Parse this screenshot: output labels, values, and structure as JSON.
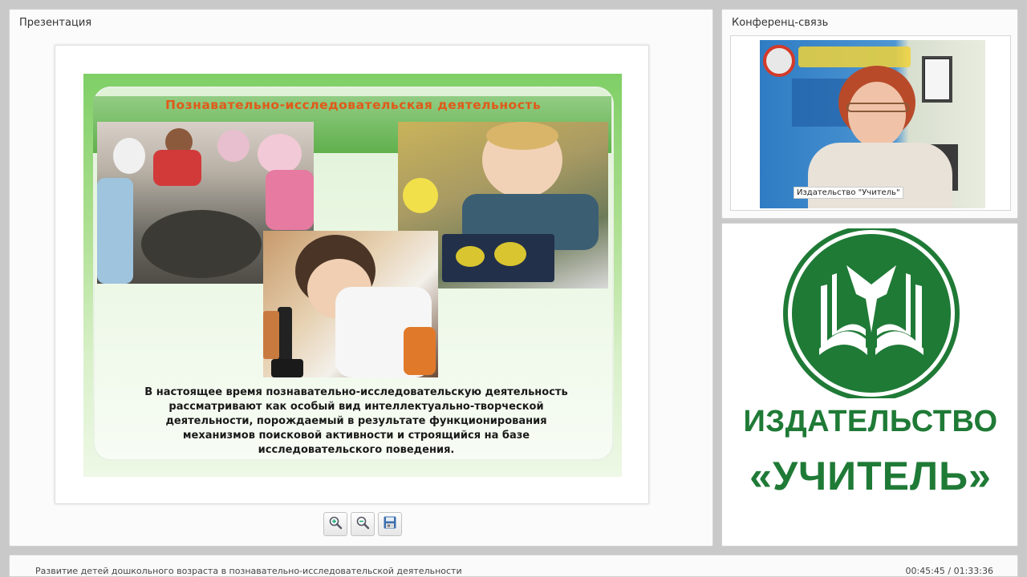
{
  "presentation": {
    "title": "Презентация",
    "slide": {
      "heading": "Познавательно-исследовательская деятельность",
      "text": "В настоящее время познавательно-исследовательскую деятельность рассматривают как особый вид интеллектуально-творческой деятельности, порождаемый в результате функционирования механизмов поисковой активности и строящийся на базе исследовательского поведения."
    },
    "toolbar": {
      "zoom_in_icon": "zoom-in-icon",
      "zoom_out_icon": "zoom-out-icon",
      "save_icon": "floppy-disk-icon"
    }
  },
  "conference": {
    "title": "Конференц-связь",
    "participant_label": "Издательство \"Учитель\""
  },
  "logo": {
    "line1": "ИЗДАТЕЛЬСТВО",
    "line2": "«УЧИТЕЛЬ»",
    "color": "#1f7a36"
  },
  "footer": {
    "title": "Развитие детей дошкольного возраста в познавательно-исследовательской деятельности",
    "time": "00:45:45 / 01:33:36"
  }
}
